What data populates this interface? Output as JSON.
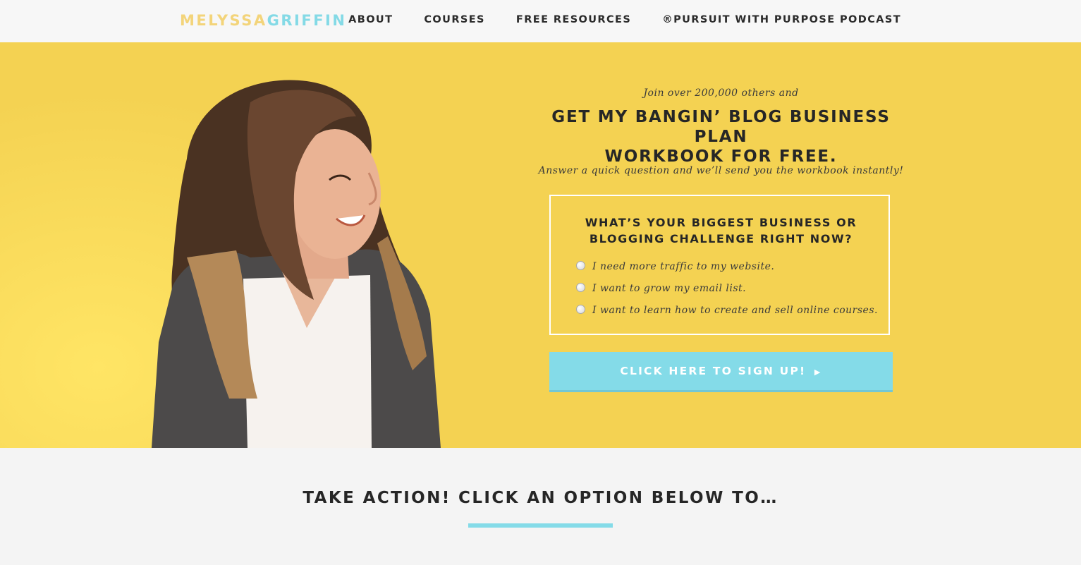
{
  "header": {
    "logo_first": "MELYSSA",
    "logo_last": "GRIFFIN",
    "nav": [
      "ABOUT",
      "COURSES",
      "FREE RESOURCES",
      "®PURSUIT WITH PURPOSE PODCAST"
    ]
  },
  "hero": {
    "kicker": "Join over 200,000 others and",
    "headline_line1": "GET MY BANGIN’ BLOG BUSINESS PLAN",
    "headline_line2": "WORKBOOK FOR FREE.",
    "subtext": "Answer a quick question and we’ll send you the workbook instantly!",
    "quiz": {
      "question_line1": "WHAT’S YOUR BIGGEST BUSINESS OR",
      "question_line2": "BLOGGING CHALLENGE RIGHT NOW?",
      "options": [
        "I need more traffic to my website.",
        "I want to grow my email list.",
        "I want to learn how to create and sell online courses."
      ]
    },
    "cta_label": "CLICK HERE TO SIGN UP!",
    "cta_arrow": "▶"
  },
  "section": {
    "title": "TAKE ACTION! CLICK AN OPTION BELOW TO…"
  },
  "colors": {
    "hero_bg": "#f4d252",
    "accent_blue": "#84dbe8",
    "logo_yellow": "#f3d47a"
  },
  "icons": {
    "cta_arrow": "play-triangle-icon",
    "radio": "radio-button-icon"
  }
}
